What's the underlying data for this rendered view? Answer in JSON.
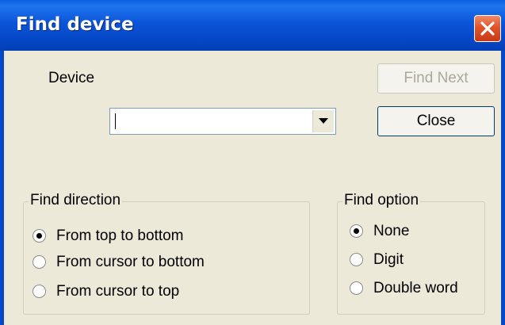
{
  "window": {
    "title": "Find device"
  },
  "device": {
    "label": "Device",
    "value": ""
  },
  "buttons": {
    "find_next": "Find Next",
    "close": "Close"
  },
  "find_direction": {
    "legend": "Find direction",
    "options": [
      "From top to bottom",
      "From cursor to bottom",
      "From cursor to top"
    ],
    "selected": "From top to bottom"
  },
  "find_option": {
    "legend": "Find option",
    "options": [
      "None",
      "Digit",
      "Double word"
    ],
    "selected": "None"
  },
  "colors": {
    "titlebar": "#0548c8",
    "close": "#e0542a",
    "dialog_bg": "#ece9d8"
  }
}
